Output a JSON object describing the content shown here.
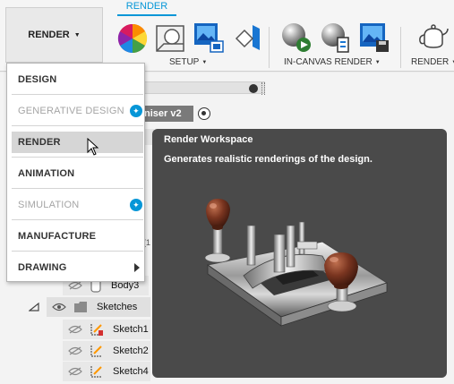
{
  "toolbar": {
    "workspace_label": "RENDER",
    "active_tab": "RENDER",
    "groups": {
      "setup": "SETUP",
      "in_canvas_render": "IN-CANVAS RENDER",
      "render": "RENDER"
    }
  },
  "workspace_menu": {
    "items": [
      {
        "label": "DESIGN",
        "enabled": true
      },
      {
        "label": "GENERATIVE DESIGN",
        "enabled": false,
        "badge": "generative-design-icon"
      },
      {
        "label": "RENDER",
        "enabled": true,
        "hovered": true
      },
      {
        "label": "ANIMATION",
        "enabled": true
      },
      {
        "label": "SIMULATION",
        "enabled": false,
        "badge": "generative-design-icon"
      },
      {
        "label": "MANUFACTURE",
        "enabled": true
      },
      {
        "label": "DRAWING",
        "enabled": true,
        "submenu": true
      }
    ]
  },
  "browser": {
    "component_fragment": "niser v2",
    "rows": [
      {
        "label": "Body3",
        "icon": "body-icon"
      },
      {
        "label": "Sketches",
        "icon": "folder-icon"
      },
      {
        "label": "Sketch1",
        "icon": "sketch-icon"
      },
      {
        "label": "Sketch2",
        "icon": "sketch-icon"
      },
      {
        "label": "Sketch4",
        "icon": "sketch-icon"
      }
    ]
  },
  "tooltip": {
    "title": "Render Workspace",
    "description": "Generates realistic renderings of the design.",
    "image": "router-plane-render"
  },
  "colors": {
    "accent": "#0696d7",
    "tooltip_bg": "#4a4a4a",
    "menu_hover": "#d6d6d6"
  }
}
